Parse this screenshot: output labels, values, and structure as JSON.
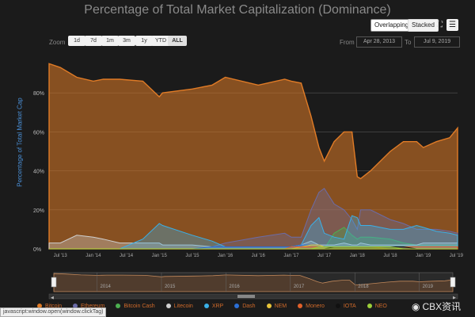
{
  "title": "Percentage of Total Market Capitalization (Dominance)",
  "toolbar": {
    "overlapping_label": "Overlapping",
    "stacked_label": "Stacked",
    "fullscreen_icon": "fullscreen-icon",
    "menu_icon": "hamburger-menu-icon"
  },
  "zoom": {
    "label": "Zoom",
    "buttons": [
      "1d",
      "7d",
      "1m",
      "3m",
      "1y",
      "YTD",
      "ALL"
    ],
    "active": "ALL"
  },
  "range": {
    "from_label": "From",
    "from_value": "Apr 28, 2013",
    "to_label": "To",
    "to_value": "Jul 9, 2019"
  },
  "chart_data": {
    "type": "area",
    "title": "Percentage of Total Market Capitalization (Dominance)",
    "ylabel": "Percentage of Total Market Cap",
    "ylim": [
      0,
      100
    ],
    "yticks": [
      "0%",
      "20%",
      "40%",
      "60%",
      "80%"
    ],
    "xticks": [
      "Jul '13",
      "Jan '14",
      "Jul '14",
      "Jan '15",
      "Jul '15",
      "Jan '16",
      "Jul '16",
      "Jan '17",
      "Jul '17",
      "Jan '18",
      "Jul '18",
      "Jan '19",
      "Jul '19"
    ],
    "navigator_years": [
      "2014",
      "2015",
      "2016",
      "2017",
      "2018",
      "2019"
    ],
    "x": [
      2013.33,
      2013.5,
      2013.75,
      2014.0,
      2014.15,
      2014.4,
      2014.75,
      2015.0,
      2015.05,
      2015.5,
      2015.8,
      2016.0,
      2016.5,
      2016.9,
      2017.0,
      2017.15,
      2017.3,
      2017.42,
      2017.5,
      2017.65,
      2017.8,
      2017.92,
      2018.0,
      2018.05,
      2018.2,
      2018.5,
      2018.7,
      2018.9,
      2019.0,
      2019.2,
      2019.4,
      2019.52
    ],
    "series": [
      {
        "name": "Bitcoin",
        "color": "#e07b26",
        "values": [
          95,
          93,
          88,
          86,
          87,
          87,
          86,
          78,
          80,
          82,
          84,
          88,
          84,
          87,
          86,
          85,
          68,
          52,
          45,
          55,
          60,
          60,
          37,
          36,
          40,
          50,
          55,
          55,
          52,
          55,
          57,
          62
        ]
      },
      {
        "name": "Ethereum",
        "color": "#6b6ca8",
        "values": [
          0,
          0,
          0,
          0,
          0,
          0,
          0,
          0,
          0,
          0,
          1,
          3,
          6,
          8,
          6,
          6,
          20,
          29,
          31,
          23,
          20,
          15,
          10,
          20,
          20,
          15,
          13,
          10,
          10,
          10,
          9,
          8
        ]
      },
      {
        "name": "Bitcoin Cash",
        "color": "#4caf50",
        "values": [
          0,
          0,
          0,
          0,
          0,
          0,
          0,
          0,
          0,
          0,
          0,
          0,
          0,
          0,
          0,
          0,
          0,
          0,
          0,
          8,
          11,
          7,
          5,
          6,
          6,
          5,
          3,
          2,
          2,
          2,
          2,
          2
        ]
      },
      {
        "name": "Litecoin",
        "color": "#d0d0d0",
        "values": [
          3,
          3,
          7,
          6,
          5,
          3,
          3,
          3,
          2,
          2,
          1,
          1,
          1,
          1,
          1,
          2,
          4,
          2,
          2,
          2,
          3,
          2,
          2,
          3,
          2,
          2,
          2,
          2,
          3,
          3,
          3,
          3
        ]
      },
      {
        "name": "XRP",
        "color": "#3ab0e8",
        "values": [
          0,
          0,
          0,
          0,
          0,
          0,
          5,
          13,
          12,
          7,
          4,
          1,
          1,
          1,
          1,
          2,
          12,
          16,
          8,
          6,
          5,
          17,
          16,
          12,
          12,
          10,
          10,
          12,
          11,
          9,
          8,
          7
        ]
      },
      {
        "name": "Dash",
        "color": "#2b6fd6",
        "values": [
          0,
          0,
          0,
          0,
          0,
          0,
          0,
          0,
          0,
          0,
          1,
          1,
          1,
          1,
          1,
          2,
          2,
          2,
          1,
          1,
          1,
          1,
          1,
          1,
          1,
          1,
          0,
          0,
          0,
          0,
          0,
          0
        ]
      },
      {
        "name": "NEM",
        "color": "#e8c43a",
        "values": [
          0,
          0,
          0,
          0,
          0,
          0,
          0,
          0,
          0,
          0,
          0,
          0,
          0,
          0,
          0,
          1,
          2,
          2,
          1,
          1,
          1,
          1,
          1,
          1,
          1,
          0,
          0,
          0,
          0,
          0,
          0,
          0
        ]
      },
      {
        "name": "Monero",
        "color": "#e0602a",
        "values": [
          0,
          0,
          0,
          0,
          0,
          0,
          0,
          0,
          0,
          0,
          0,
          0,
          0,
          0,
          1,
          1,
          1,
          1,
          1,
          1,
          1,
          1,
          1,
          1,
          1,
          1,
          1,
          1,
          1,
          1,
          1,
          1
        ]
      },
      {
        "name": "IOTA",
        "color": "#111111",
        "values": [
          0,
          0,
          0,
          0,
          0,
          0,
          0,
          0,
          0,
          0,
          0,
          0,
          0,
          0,
          0,
          0,
          0,
          0,
          0,
          1,
          1,
          1,
          1,
          1,
          1,
          1,
          1,
          0,
          0,
          0,
          0,
          0
        ]
      },
      {
        "name": "NEO",
        "color": "#9bcf3a",
        "values": [
          0,
          0,
          0,
          0,
          0,
          0,
          0,
          0,
          0,
          0,
          0,
          0,
          0,
          0,
          0,
          0,
          0,
          1,
          1,
          1,
          1,
          1,
          1,
          1,
          1,
          1,
          0,
          0,
          0,
          0,
          0,
          0
        ]
      }
    ]
  },
  "watermark": "CBX资讯",
  "statusbar": "javascript:window.open(window.clickTag)"
}
